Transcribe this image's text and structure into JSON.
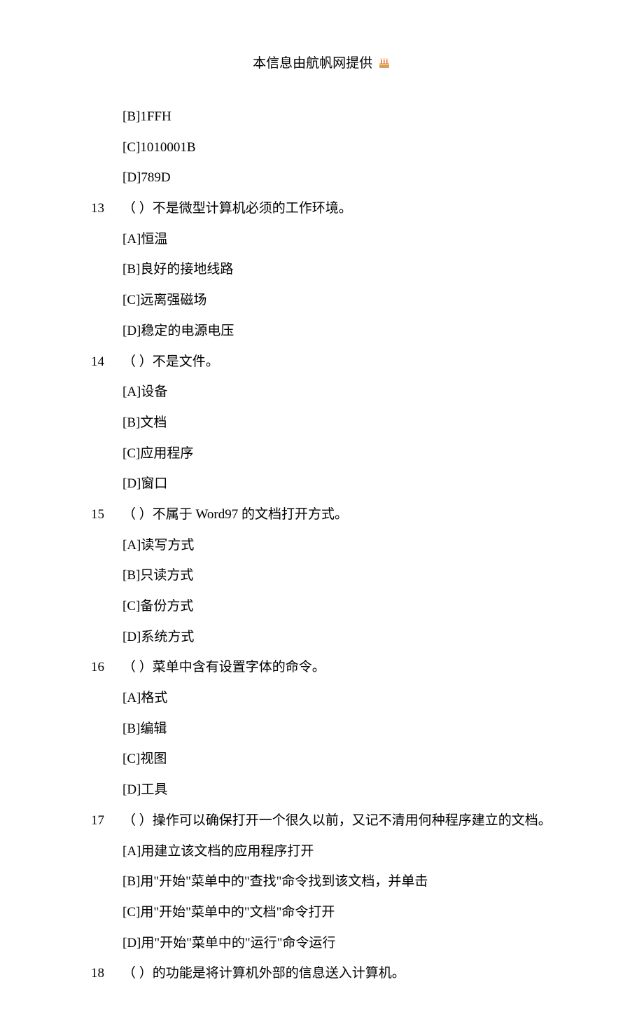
{
  "header": {
    "text": "本信息由航帆网提供"
  },
  "lines": [
    {
      "type": "option",
      "text": "[B]1FFH"
    },
    {
      "type": "option",
      "text": "[C]1010001B"
    },
    {
      "type": "option",
      "text": "[D]789D"
    },
    {
      "type": "question",
      "num": "13",
      "text": "（  ）不是微型计算机必须的工作环境。"
    },
    {
      "type": "option",
      "text": "[A]恒温"
    },
    {
      "type": "option",
      "text": "[B]良好的接地线路"
    },
    {
      "type": "option",
      "text": "[C]远离强磁场"
    },
    {
      "type": "option",
      "text": "[D]稳定的电源电压"
    },
    {
      "type": "question",
      "num": "14",
      "text": "（  ）不是文件。"
    },
    {
      "type": "option",
      "text": "[A]设备"
    },
    {
      "type": "option",
      "text": "[B]文档"
    },
    {
      "type": "option",
      "text": "[C]应用程序"
    },
    {
      "type": "option",
      "text": "[D]窗口"
    },
    {
      "type": "question",
      "num": "15",
      "text": "（  ）不属于 Word97 的文档打开方式。"
    },
    {
      "type": "option",
      "text": "[A]读写方式"
    },
    {
      "type": "option",
      "text": "[B]只读方式"
    },
    {
      "type": "option",
      "text": "[C]备份方式"
    },
    {
      "type": "option",
      "text": "[D]系统方式"
    },
    {
      "type": "question",
      "num": "16",
      "text": "（  ）菜单中含有设置字体的命令。"
    },
    {
      "type": "option",
      "text": "[A]格式"
    },
    {
      "type": "option",
      "text": "[B]编辑"
    },
    {
      "type": "option",
      "text": "[C]视图"
    },
    {
      "type": "option",
      "text": "[D]工具"
    },
    {
      "type": "question",
      "num": "17",
      "text": "（  ）操作可以确保打开一个很久以前，又记不清用何种程序建立的文档。"
    },
    {
      "type": "option",
      "text": "[A]用建立该文档的应用程序打开"
    },
    {
      "type": "option",
      "text": "[B]用\"开始\"菜单中的\"查找\"命令找到该文档，并单击"
    },
    {
      "type": "option",
      "text": "[C]用\"开始\"菜单中的\"文档\"命令打开"
    },
    {
      "type": "option",
      "text": "[D]用\"开始\"菜单中的\"运行\"命令运行"
    },
    {
      "type": "question",
      "num": "18",
      "text": "（  ）的功能是将计算机外部的信息送入计算机。"
    }
  ]
}
